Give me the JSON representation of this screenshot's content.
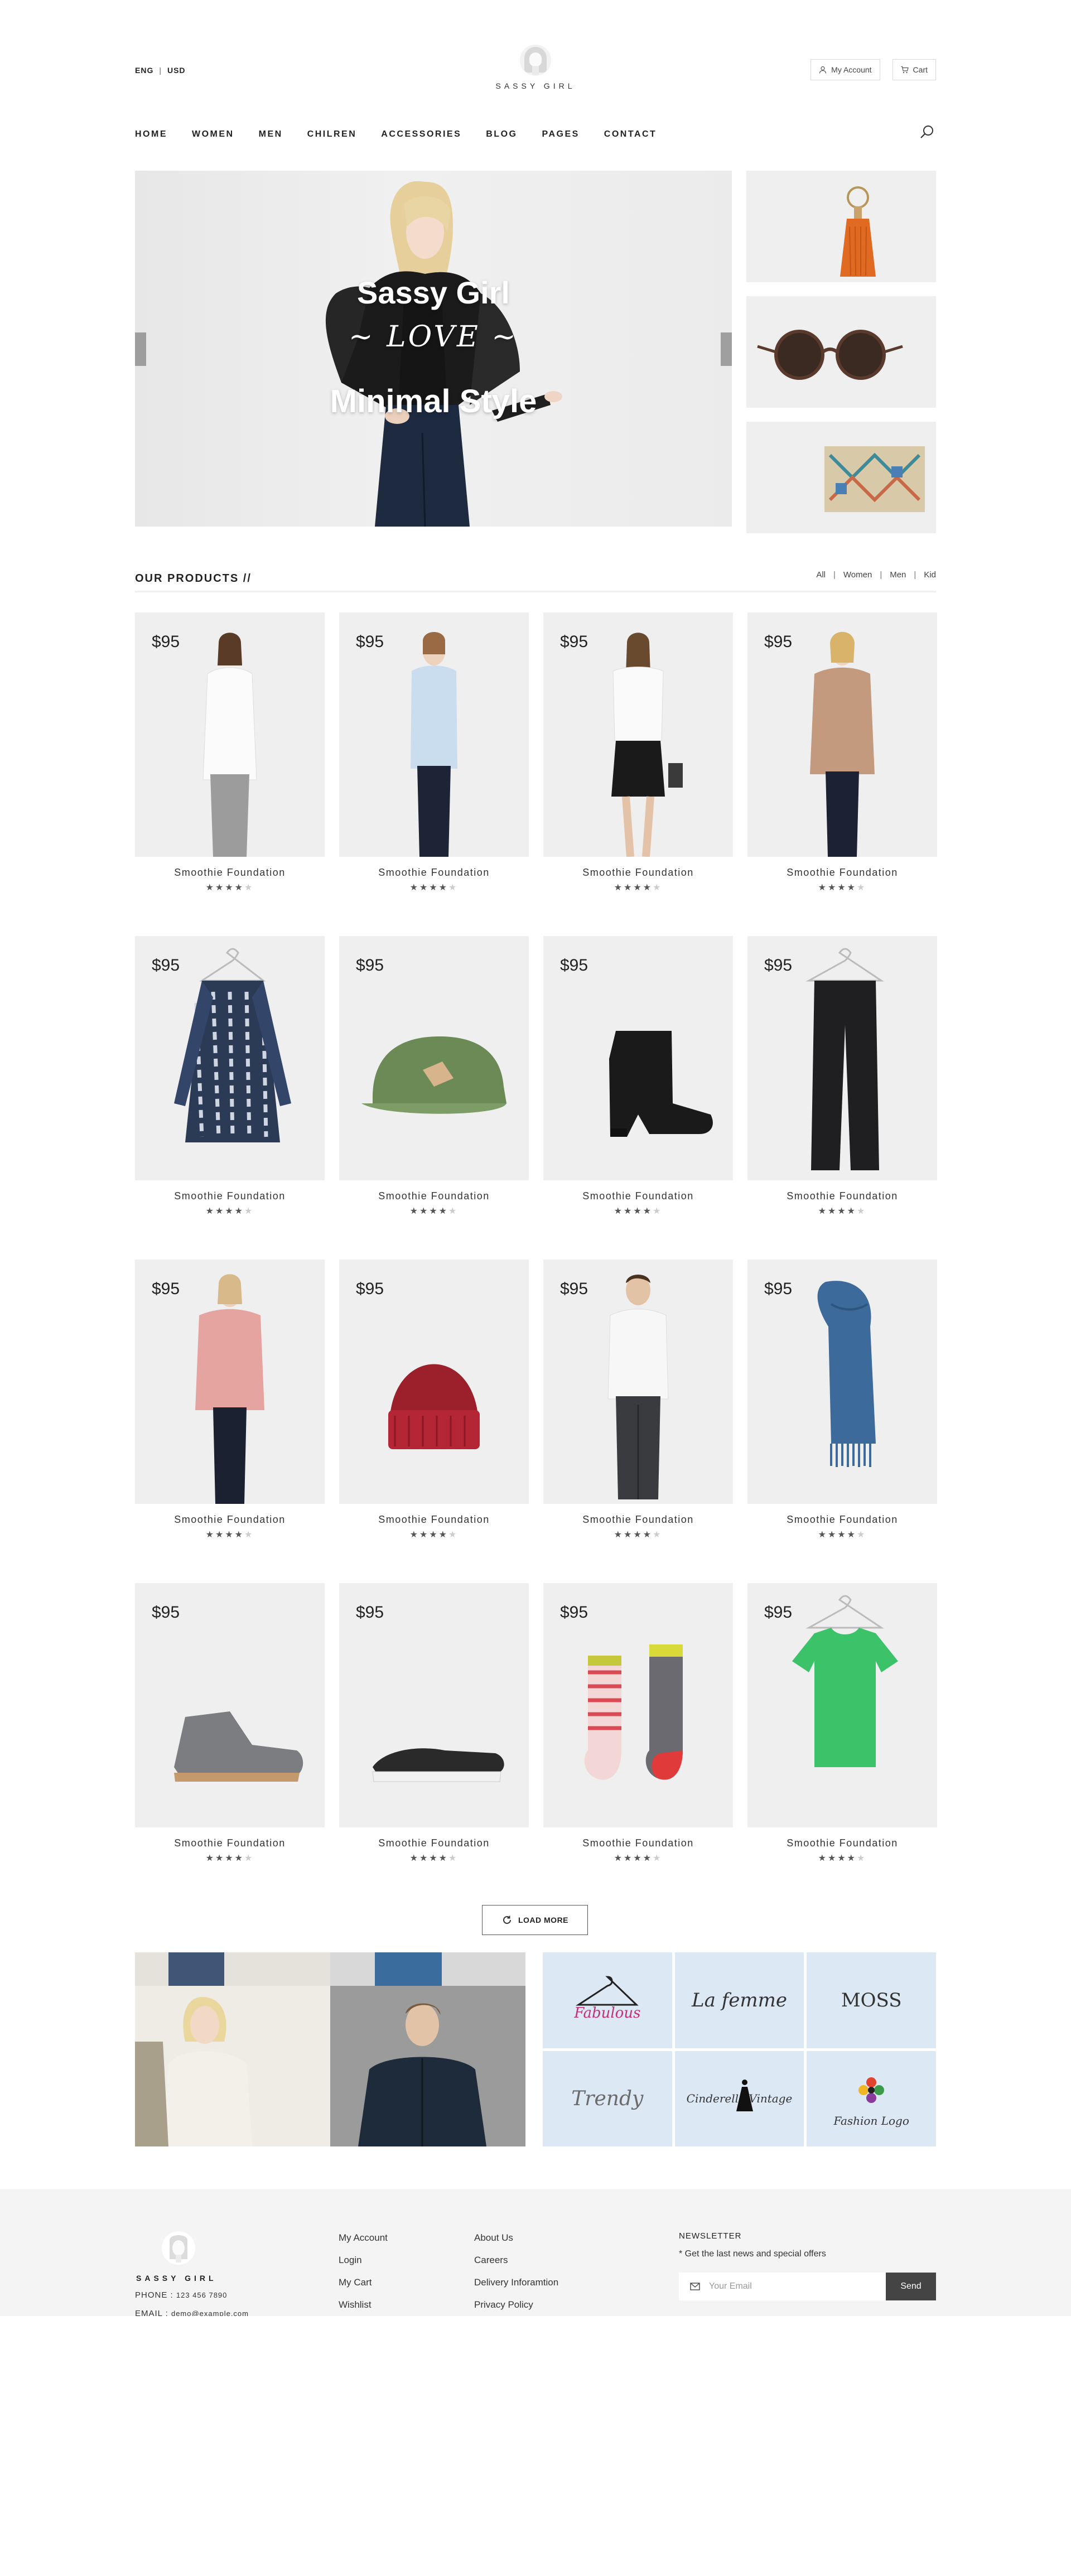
{
  "header": {
    "lang": "ENG",
    "currency": "USD",
    "brand": "SASSY GIRL",
    "account_label": "My Account",
    "cart_label": "Cart"
  },
  "nav": {
    "items": [
      "HOME",
      "WOMEN",
      "MEN",
      "CHILREN",
      "ACCESSORIES",
      "BLOG",
      "PAGES",
      "CONTACT"
    ]
  },
  "hero": {
    "line1": "Sassy Girl",
    "line2": "~ LOVE ~",
    "line3": "Minimal Style"
  },
  "products": {
    "title": "OUR PRODUCTS //",
    "filters": [
      "All",
      "Women",
      "Men",
      "Kid"
    ],
    "items": [
      {
        "price": "$95",
        "name": "Smoothie Foundation",
        "rating": 4,
        "icon": "woman-white-shirt"
      },
      {
        "price": "$95",
        "name": "Smoothie Foundation",
        "rating": 4,
        "icon": "woman-blue-shirt"
      },
      {
        "price": "$95",
        "name": "Smoothie Foundation",
        "rating": 4,
        "icon": "woman-black-skirt"
      },
      {
        "price": "$95",
        "name": "Smoothie Foundation",
        "rating": 4,
        "icon": "woman-tan-sweater"
      },
      {
        "price": "$95",
        "name": "Smoothie Foundation",
        "rating": 4,
        "icon": "printed-dress"
      },
      {
        "price": "$95",
        "name": "Smoothie Foundation",
        "rating": 4,
        "icon": "green-cap"
      },
      {
        "price": "$95",
        "name": "Smoothie Foundation",
        "rating": 4,
        "icon": "black-boot"
      },
      {
        "price": "$95",
        "name": "Smoothie Foundation",
        "rating": 4,
        "icon": "black-jeans"
      },
      {
        "price": "$95",
        "name": "Smoothie Foundation",
        "rating": 4,
        "icon": "woman-pink-sweater"
      },
      {
        "price": "$95",
        "name": "Smoothie Foundation",
        "rating": 4,
        "icon": "red-beanie"
      },
      {
        "price": "$95",
        "name": "Smoothie Foundation",
        "rating": 4,
        "icon": "man-white-shirt"
      },
      {
        "price": "$95",
        "name": "Smoothie Foundation",
        "rating": 4,
        "icon": "blue-scarf"
      },
      {
        "price": "$95",
        "name": "Smoothie Foundation",
        "rating": 4,
        "icon": "grey-desert-boot"
      },
      {
        "price": "$95",
        "name": "Smoothie Foundation",
        "rating": 4,
        "icon": "black-slip-on"
      },
      {
        "price": "$95",
        "name": "Smoothie Foundation",
        "rating": 4,
        "icon": "striped-socks"
      },
      {
        "price": "$95",
        "name": "Smoothie Foundation",
        "rating": 4,
        "icon": "green-tshirt"
      }
    ],
    "load_more": "LOAD MORE"
  },
  "brands": [
    "Fabulous",
    "La femme",
    "MOSS",
    "Trendy",
    "Cinderella Vintage",
    "Fashion Logo"
  ],
  "footer": {
    "brand": "SASSY GIRL",
    "phone_label": "PHONE :",
    "phone": "123 456 7890",
    "email_label": "EMAIL :",
    "email": "demo@example.com",
    "col1": [
      "My Account",
      "Login",
      "My Cart",
      "Wishlist"
    ],
    "col2": [
      "About Us",
      "Careers",
      "Delivery Inforamtion",
      "Privacy Policy"
    ],
    "newsletter_title": "NEWSLETTER",
    "newsletter_sub": "* Get the last news and special offers",
    "email_placeholder": "Your Email",
    "send_label": "Send"
  }
}
